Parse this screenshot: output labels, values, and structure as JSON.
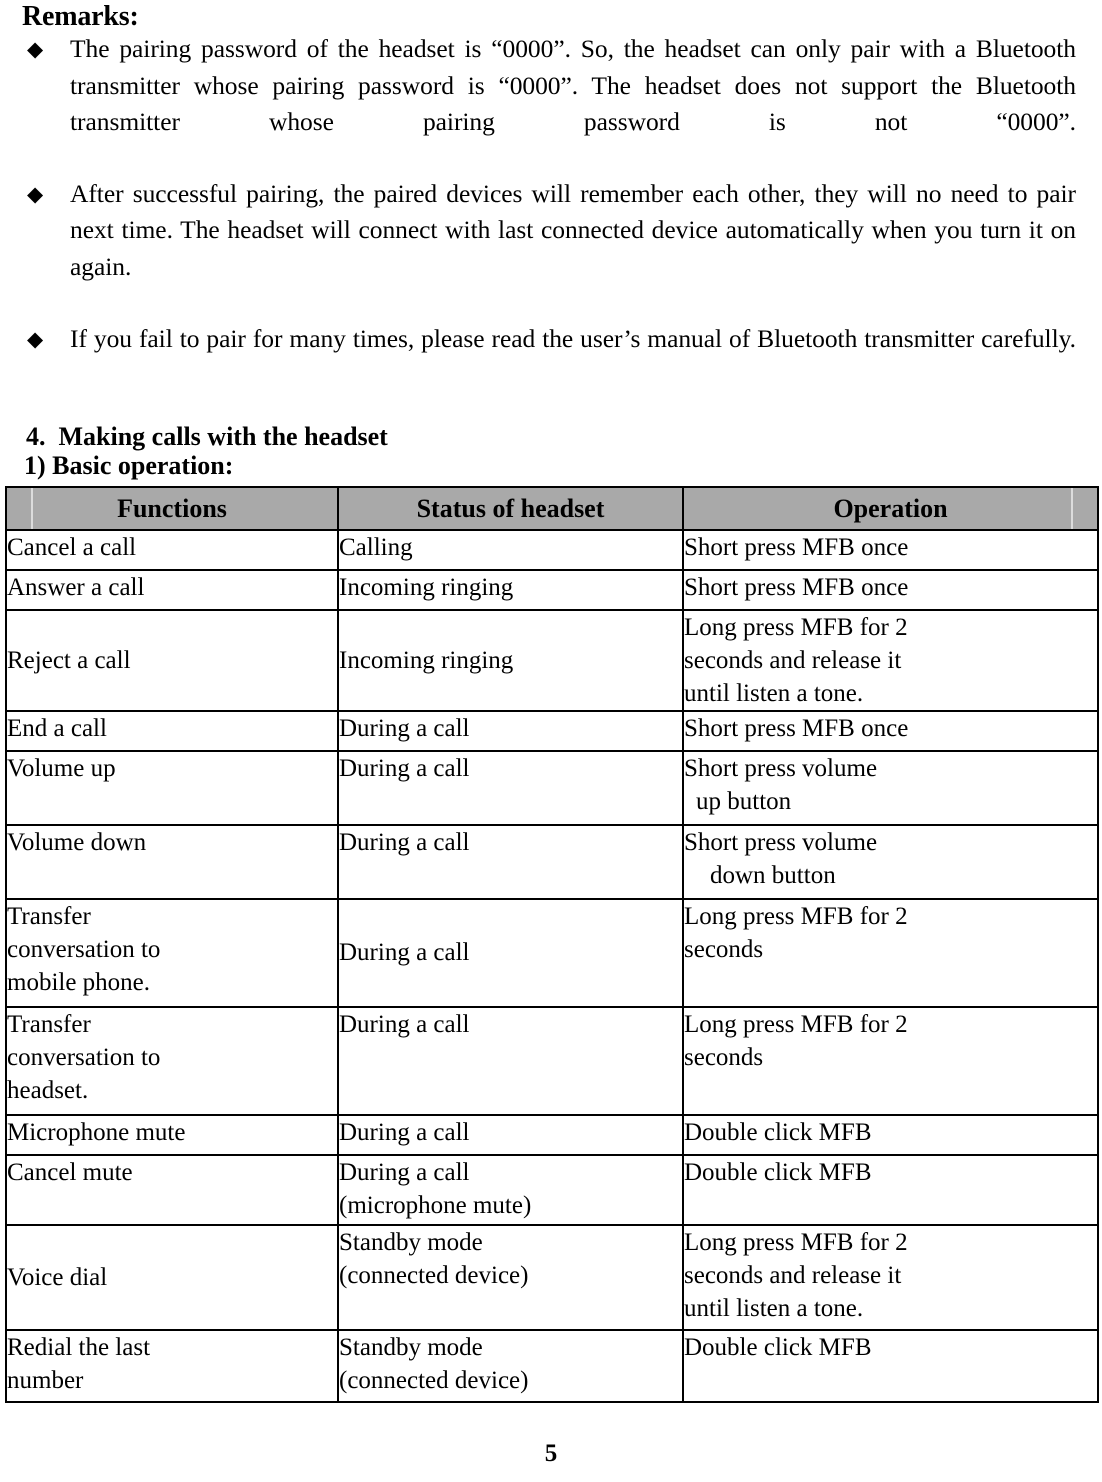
{
  "document": {
    "remarks_heading": "Remarks:",
    "bullet_glyph": "◆",
    "remarks": [
      "The pairing password of the headset is “0000”. So, the headset can only pair with a Bluetooth transmitter whose pairing password is “0000”. The headset does not support the Bluetooth transmitter whose pairing password is not “0000”.",
      "After successful pairing, the paired devices will remember each other, they will no need to pair next time. The headset will connect with last connected device automatically when you turn it on again.",
      "If you fail to pair for many times, please read the user’s manual of Bluetooth transmitter carefully."
    ],
    "section_heading": "4.  Making calls with the headset",
    "sub_heading": "1) Basic operation:",
    "page_number": "5"
  },
  "table": {
    "headers": {
      "col1": "Functions",
      "col2": "Status of headset",
      "col3": "Operation"
    },
    "rows": [
      {
        "function": "Cancel a call",
        "status": "Calling",
        "operation_lines": [
          "Short press MFB once"
        ]
      },
      {
        "function": "Answer a call",
        "status": "Incoming ringing",
        "operation_lines": [
          "Short press MFB once"
        ]
      },
      {
        "function": "Reject a call",
        "status": "Incoming ringing",
        "operation_lines": [
          "Long press MFB for 2",
          "seconds and release it",
          "until listen a tone."
        ]
      },
      {
        "function": "End a call",
        "status": "During a call",
        "operation_lines": [
          "Short press MFB once"
        ]
      },
      {
        "function": "Volume up",
        "status": "During a call",
        "operation_lines": [
          "Short press volume",
          "up button"
        ]
      },
      {
        "function": "Volume down",
        "status": "During a call",
        "operation_lines": [
          "Short press volume",
          "down button"
        ]
      },
      {
        "function_lines": [
          "Transfer",
          "conversation to",
          "mobile phone."
        ],
        "status": "During a call",
        "operation_lines": [
          "Long press MFB for 2",
          "seconds"
        ]
      },
      {
        "function_lines": [
          "Transfer",
          "conversation to",
          "headset."
        ],
        "status": "During a call",
        "operation_lines": [
          "Long press MFB for 2",
          "seconds"
        ]
      },
      {
        "function": "Microphone mute",
        "status": "During a call",
        "operation_lines": [
          "Double click MFB"
        ]
      },
      {
        "function": "Cancel mute",
        "status_lines": [
          "During a call",
          "(microphone mute)"
        ],
        "operation_lines": [
          "Double click MFB"
        ]
      },
      {
        "function": "Voice dial",
        "status_lines": [
          "Standby mode",
          "(connected device)"
        ],
        "operation_lines": [
          "Long press MFB for 2",
          "seconds and release it",
          "until listen a tone."
        ]
      },
      {
        "function_lines": [
          "Redial the last",
          "number"
        ],
        "status_lines": [
          "Standby mode",
          "(connected device)"
        ],
        "operation_lines": [
          "Double click MFB"
        ]
      }
    ]
  },
  "colors": {
    "header_gray": "#a9a9a9",
    "border_black": "#000000",
    "text_black": "#000000"
  }
}
